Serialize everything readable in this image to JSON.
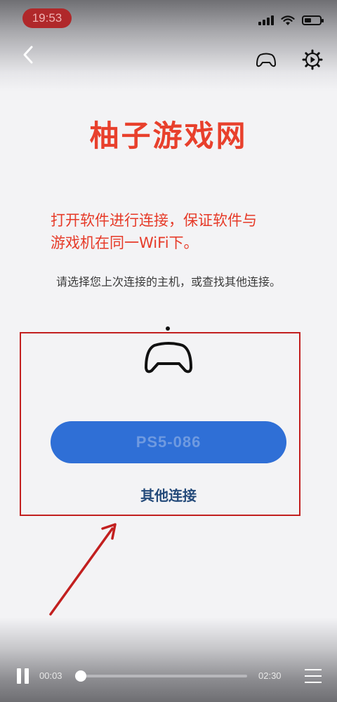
{
  "status_bar": {
    "time": "19:53",
    "icons": [
      "cellular-signal-icon",
      "wifi-icon",
      "battery-icon"
    ]
  },
  "nav": {
    "back_icon": "chevron-left-icon",
    "controller_icon": "gamepad-icon",
    "settings_icon": "gear-icon"
  },
  "content": {
    "site_title": "柚子游戏网",
    "note_line1": "打开软件进行连接，保证软件与",
    "note_line2": "游戏机在同一WiFi下。",
    "subtitle": "请选择您上次连接的主机，或查找其他连接。",
    "console_button_label": "PS5-086",
    "other_connection_label": "其他连接"
  },
  "player": {
    "elapsed": "00:03",
    "total": "02:30",
    "progress_fraction": 0.02,
    "pause_icon": "pause-icon",
    "menu_icon": "menu-icon"
  },
  "colors": {
    "title_red": "#e8402c",
    "highlight_border": "#c21f1f",
    "button_blue": "#2f6fd6",
    "link_blue": "#244a7a"
  }
}
